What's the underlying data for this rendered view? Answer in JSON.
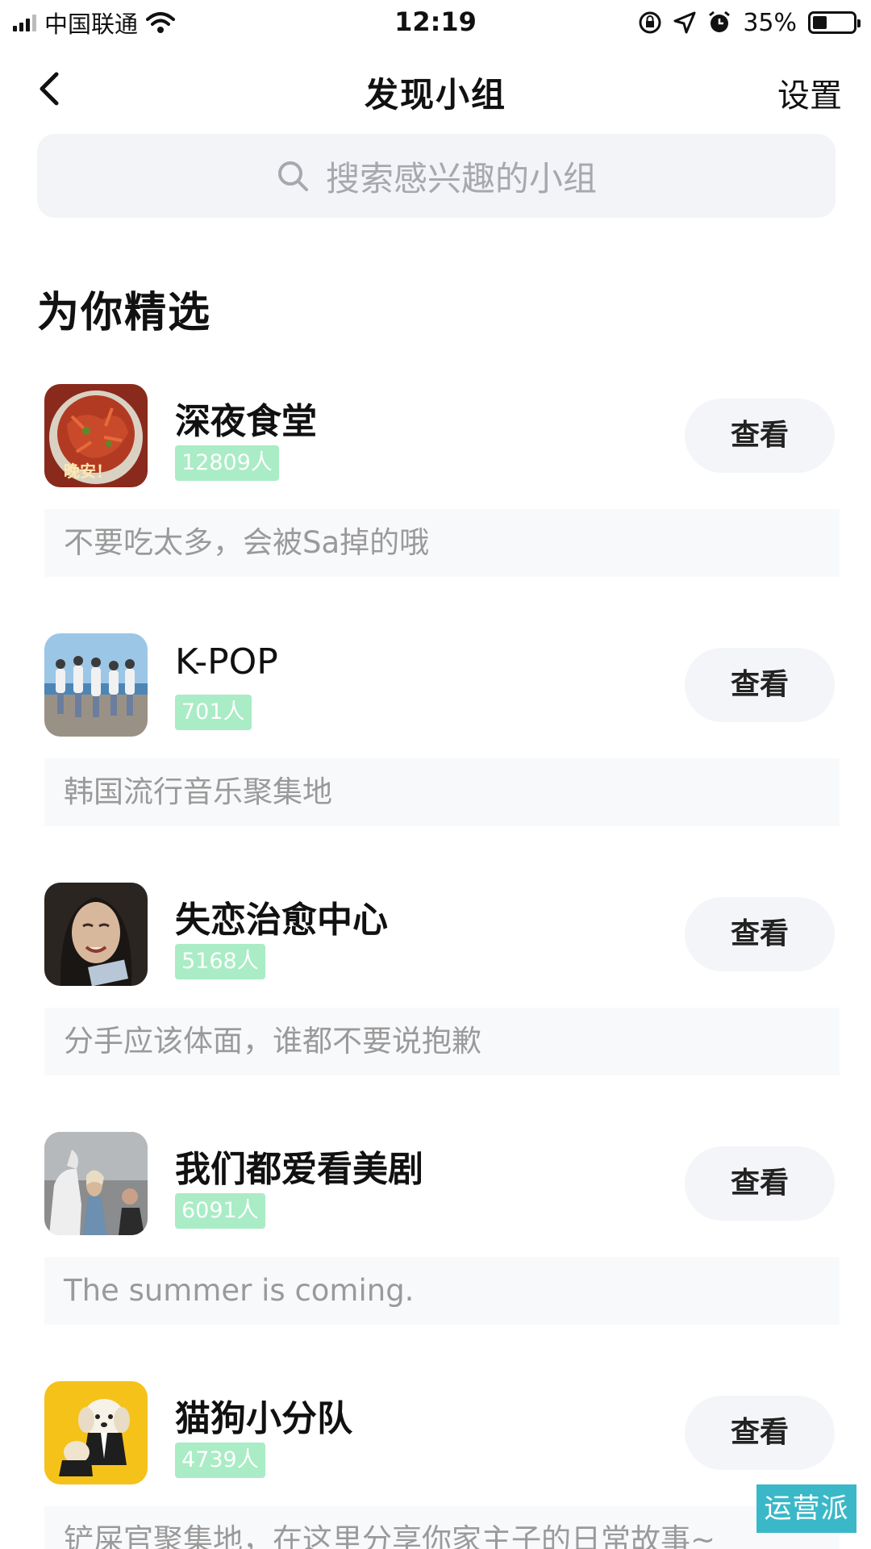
{
  "status_bar": {
    "carrier": "中国联通",
    "time": "12:19",
    "battery": "35%",
    "battery_level": 0.35
  },
  "nav": {
    "title": "发现小组",
    "settings": "设置"
  },
  "search": {
    "placeholder": "搜索感兴趣的小组"
  },
  "section": {
    "title": "为你精选"
  },
  "groups": [
    {
      "name": "深夜食堂",
      "members": "12809人",
      "description": "不要吃太多，会被Sa掉的哦",
      "button": "查看",
      "avatar_caption": "晚安！"
    },
    {
      "name": "K-POP",
      "members": "701人",
      "description": "韩国流行音乐聚集地",
      "button": "查看"
    },
    {
      "name": "失恋治愈中心",
      "members": "5168人",
      "description": "分手应该体面，谁都不要说抱歉",
      "button": "查看"
    },
    {
      "name": "我们都爱看美剧",
      "members": "6091人",
      "description": "The summer is coming.",
      "button": "查看"
    },
    {
      "name": "猫狗小分队",
      "members": "4739人",
      "description": "铲屎官聚集地，在这里分享你家主子的日常故事~",
      "button": "查看"
    }
  ],
  "watermark": "运营派",
  "icons": [
    "signal-icon",
    "wifi-icon",
    "rotation-lock-icon",
    "location-icon",
    "alarm-icon",
    "battery-icon",
    "back-chevron-icon",
    "search-icon"
  ]
}
